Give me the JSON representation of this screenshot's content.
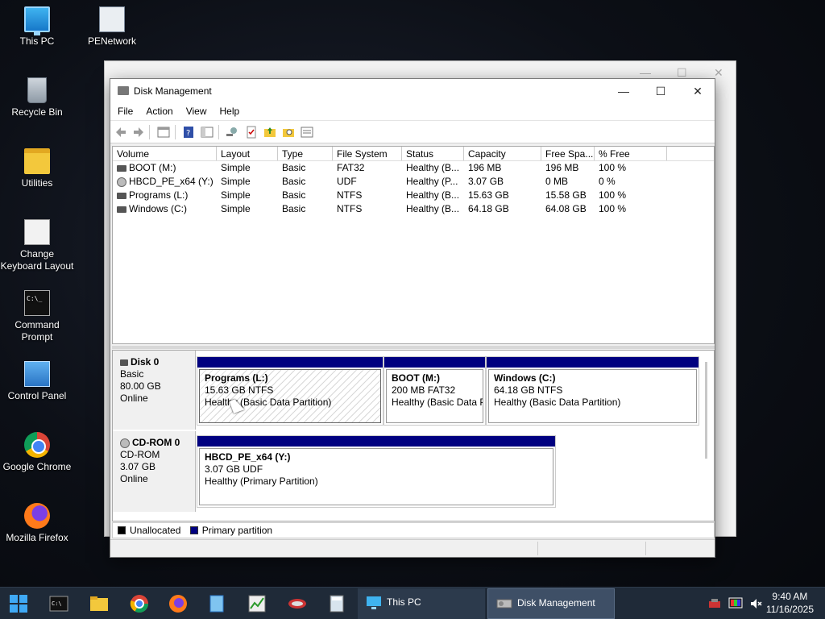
{
  "desktop": {
    "icons": [
      {
        "label": "This PC",
        "icon": "computer-icon"
      },
      {
        "label": "PENetwork",
        "icon": "network-icon"
      },
      {
        "label": "Recycle Bin",
        "icon": "recycle-bin-icon"
      },
      {
        "label": "Utilities",
        "icon": "folder-icon"
      },
      {
        "label_line1": "Change",
        "label_line2": "Keyboard Layout",
        "icon": "keyboard-settings-icon"
      },
      {
        "label_line1": "Command",
        "label_line2": "Prompt",
        "icon": "command-prompt-icon"
      },
      {
        "label": "Control Panel",
        "icon": "control-panel-icon"
      },
      {
        "label": "Google Chrome",
        "icon": "chrome-icon"
      },
      {
        "label": "Mozilla Firefox",
        "icon": "firefox-icon"
      }
    ]
  },
  "window": {
    "title": "Disk Management",
    "controls": {
      "minimize": "—",
      "maximize": "☐",
      "close": "✕"
    },
    "menu": [
      "File",
      "Action",
      "View",
      "Help"
    ]
  },
  "volumes": {
    "columns": [
      "Volume",
      "Layout",
      "Type",
      "File System",
      "Status",
      "Capacity",
      "Free Spa...",
      "% Free"
    ],
    "rows": [
      {
        "volume": "BOOT (M:)",
        "layout": "Simple",
        "type": "Basic",
        "fs": "FAT32",
        "status": "Healthy (B...",
        "capacity": "196 MB",
        "free": "196 MB",
        "pct": "100 %"
      },
      {
        "volume": "HBCD_PE_x64 (Y:)",
        "layout": "Simple",
        "type": "Basic",
        "fs": "UDF",
        "status": "Healthy (P...",
        "capacity": "3.07 GB",
        "free": "0 MB",
        "pct": "0 %"
      },
      {
        "volume": "Programs (L:)",
        "layout": "Simple",
        "type": "Basic",
        "fs": "NTFS",
        "status": "Healthy (B...",
        "capacity": "15.63 GB",
        "free": "15.58 GB",
        "pct": "100 %"
      },
      {
        "volume": "Windows (C:)",
        "layout": "Simple",
        "type": "Basic",
        "fs": "NTFS",
        "status": "Healthy (B...",
        "capacity": "64.18 GB",
        "free": "64.08 GB",
        "pct": "100 %"
      }
    ]
  },
  "disks": [
    {
      "name": "Disk 0",
      "kind": "Basic",
      "size": "80.00 GB",
      "state": "Online",
      "partitions": [
        {
          "name": "Programs  (L:)",
          "size": "15.63 GB NTFS",
          "status": "Healthy (Basic Data Partition)"
        },
        {
          "name": "BOOT  (M:)",
          "size": "200 MB FAT32",
          "status": "Healthy (Basic Data P"
        },
        {
          "name": "Windows  (C:)",
          "size": "64.18 GB NTFS",
          "status": "Healthy (Basic Data Partition)"
        }
      ]
    },
    {
      "name": "CD-ROM 0",
      "kind": "CD-ROM",
      "size": "3.07 GB",
      "state": "Online",
      "partitions": [
        {
          "name": "HBCD_PE_x64  (Y:)",
          "size": "3.07 GB UDF",
          "status": "Healthy (Primary Partition)"
        }
      ]
    }
  ],
  "legend": [
    {
      "label": "Unallocated",
      "color": "#000000"
    },
    {
      "label": "Primary partition",
      "color": "#000080"
    }
  ],
  "taskbar": {
    "tasks": [
      {
        "label": "This PC"
      },
      {
        "label": "Disk Management"
      }
    ],
    "clock": {
      "time": "9:40 AM",
      "date": "11/16/2025"
    }
  }
}
